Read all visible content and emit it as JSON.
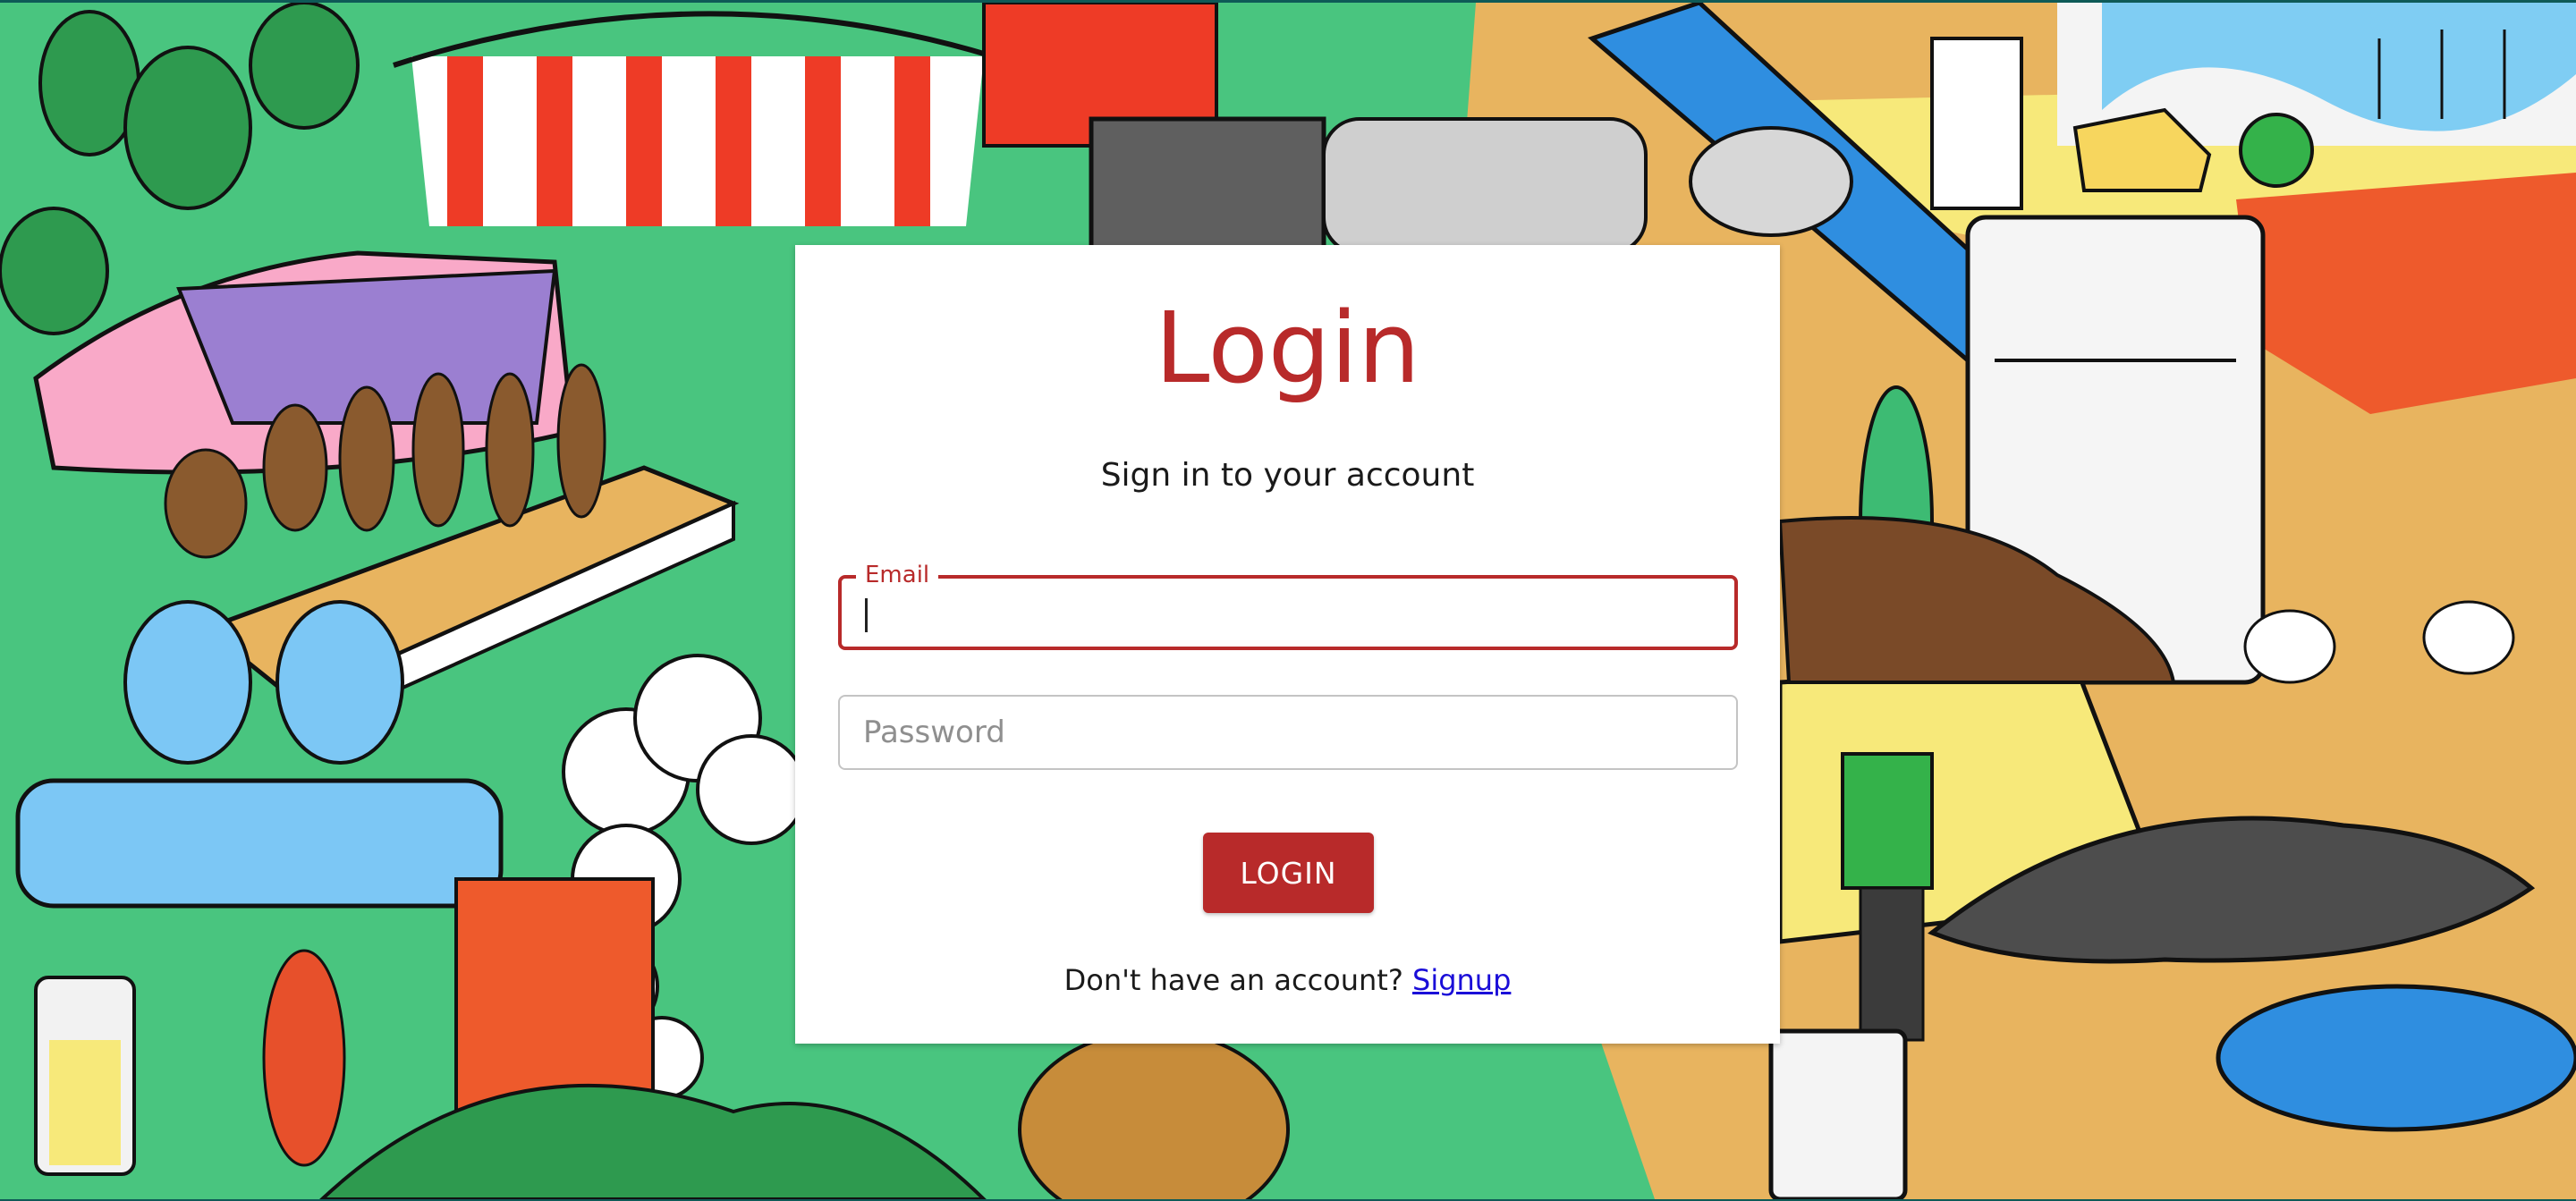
{
  "login": {
    "title": "Login",
    "subtitle": "Sign in to your account",
    "email_label": "Email",
    "email_value": "",
    "password_placeholder": "Password",
    "password_value": "",
    "button_label": "LOGIN",
    "signup_prompt": "Don't have an account?",
    "signup_link": "Signup"
  },
  "colors": {
    "accent": "#b82a2a",
    "link": "#1a0dd8",
    "background_green": "#49c57f",
    "background_sand": "#e8b45f",
    "background_yellow": "#f7e97a"
  }
}
